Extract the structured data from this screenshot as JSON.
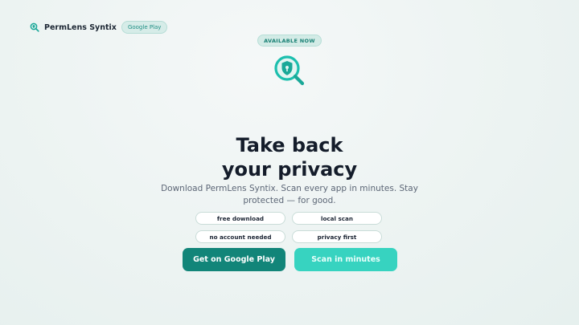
{
  "header": {
    "brand_name": "PermLens Syntix",
    "store_badge": "Google Play",
    "logo_icon": "magnifier-shield-icon"
  },
  "hero": {
    "availability_badge": "AVAILABLE NOW",
    "icon": "shield-magnifier-icon",
    "title_line1": "Take back",
    "title_line2": "your privacy",
    "subtitle": "Download PermLens Syntix. Scan every app in minutes. Stay protected — for good."
  },
  "features": [
    "free download",
    "local scan",
    "no account needed",
    "privacy first"
  ],
  "actions": {
    "primary_label": "Get on Google Play",
    "secondary_label": "Scan in minutes"
  },
  "colors": {
    "accent": "#128579",
    "accent_light": "#37d3c0",
    "text_dark": "#141c2a"
  }
}
